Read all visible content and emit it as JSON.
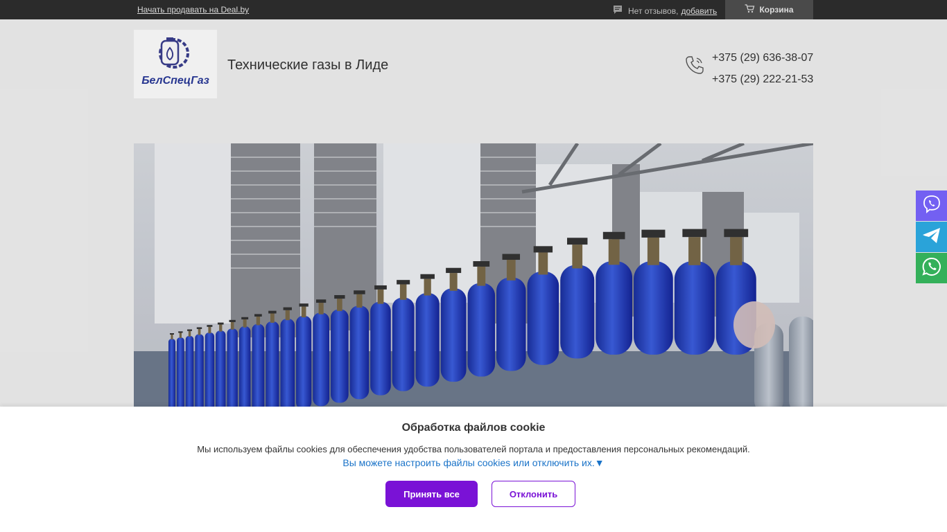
{
  "topbar": {
    "sell_link": "Начать продавать на Deal.by",
    "reviews_text": "Нет отзывов,",
    "reviews_add": "добавить",
    "cart_label": "Корзина"
  },
  "header": {
    "logo_text": "БелСпецГаз",
    "title": "Технические газы в Лиде",
    "phones": [
      "+375 (29) 636-38-07",
      "+375 (29) 222-21-53"
    ]
  },
  "messengers": {
    "items": [
      {
        "icon": "viber-icon",
        "color": "#7360f2"
      },
      {
        "icon": "telegram-icon",
        "color": "#2aa3d9"
      },
      {
        "icon": "whatsapp-icon",
        "color": "#34b05a"
      }
    ]
  },
  "cookie": {
    "title": "Обработка файлов cookie",
    "text": "Мы используем файлы cookies для обеспечения удобства пользователей портала и предоставления персональных рекомендаций.",
    "settings_link": "Вы можете настроить файлы cookies или отключить их.",
    "settings_arrow": "▼",
    "accept_label": "Принять все",
    "decline_label": "Отклонить"
  },
  "colors": {
    "accent": "#7a12d6",
    "link": "#1a73c8",
    "topbar": "#2b2b2b"
  }
}
